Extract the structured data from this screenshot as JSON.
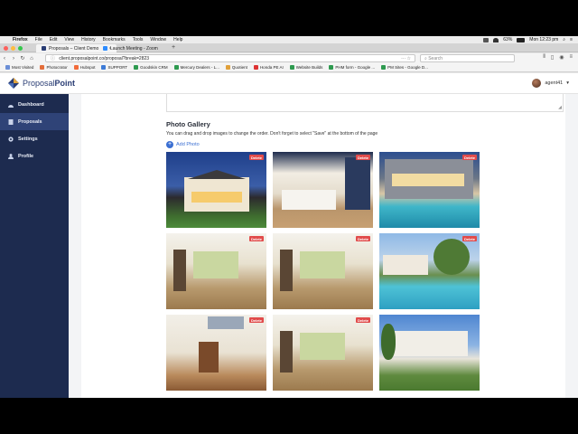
{
  "menubar": {
    "app": "Firefox",
    "items": [
      "File",
      "Edit",
      "View",
      "History",
      "Bookmarks",
      "Tools",
      "Window",
      "Help"
    ],
    "battery": "63%",
    "clock": "Mon 12:23 pm"
  },
  "tabs": [
    {
      "label": "Proposals – Client Demo",
      "active": true
    },
    {
      "label": "Launch Meeting - Zoom",
      "active": false
    }
  ],
  "url": "client.proposalpoint.co/proposal?break=2823",
  "search_placeholder": "Search",
  "bookmarks": [
    "Most Visited",
    "Photocrator",
    "Hubspot",
    "SUPPORT",
    "Goodskin CRM",
    "Mercury Dealers - L...",
    "Quotient",
    "Honda PE AI",
    "Website Builds",
    "PHM form - Google ...",
    "PM Sites - Google D..."
  ],
  "brand": {
    "pre": "Proposal",
    "bold": "Point",
    "color": "#2a3d74"
  },
  "user": {
    "name": "agent41"
  },
  "sidebar": {
    "items": [
      {
        "label": "Dashboard",
        "icon": "dashboard-icon",
        "active": false
      },
      {
        "label": "Proposals",
        "icon": "document-icon",
        "active": true
      },
      {
        "label": "Settings",
        "icon": "gear-icon",
        "active": false
      },
      {
        "label": "Profile",
        "icon": "person-icon",
        "active": false
      }
    ]
  },
  "gallery": {
    "title": "Photo Gallery",
    "help": "You can drag and drop images to change the order. Don't forget to select \"Save\" at the bottom of the page",
    "add_label": "Add Photo",
    "delete_label": "Delete",
    "photos": [
      {
        "subject": "two-storey house at dusk"
      },
      {
        "subject": "modern kitchen interior"
      },
      {
        "subject": "house with pool at dusk"
      },
      {
        "subject": "interior living area"
      },
      {
        "subject": "interior living area"
      },
      {
        "subject": "backyard pool"
      },
      {
        "subject": "entry with staircase"
      },
      {
        "subject": "interior living area"
      },
      {
        "subject": "white two-storey house"
      }
    ]
  },
  "colors": {
    "sidebar": "#1d2b4f",
    "sidebar_active": "#2f4377",
    "accent": "#3b6fd2",
    "delete": "#e14b4b"
  }
}
